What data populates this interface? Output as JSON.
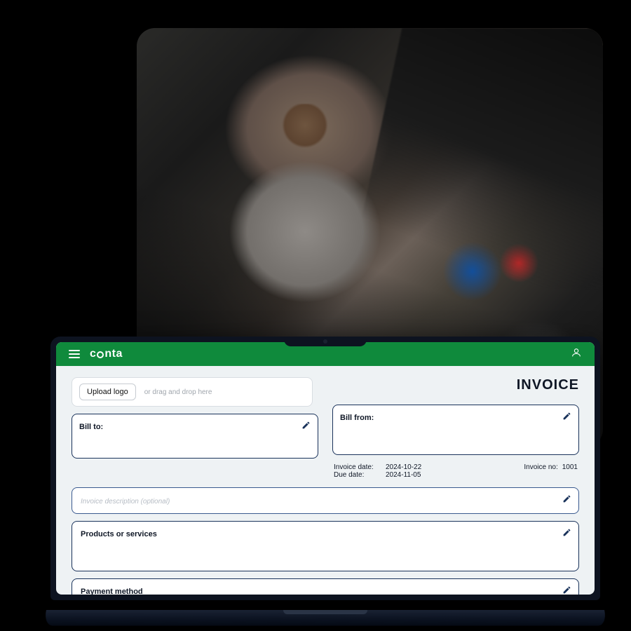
{
  "brand": {
    "name_prefix": "c",
    "name_suffix": "nta"
  },
  "header_title": "INVOICE",
  "upload": {
    "button": "Upload logo",
    "hint": "or drag and drop here"
  },
  "bill_to": {
    "label": "Bill to:"
  },
  "bill_from": {
    "label": "Bill from:"
  },
  "dates": {
    "invoice_date_label": "Invoice date:",
    "invoice_date": "2024-10-22",
    "due_date_label": "Due date:",
    "due_date": "2024-11-05",
    "invoice_no_label": "Invoice no:",
    "invoice_no": "1001"
  },
  "description": {
    "placeholder": "Invoice description (optional)"
  },
  "products": {
    "label": "Products or services"
  },
  "payment": {
    "label": "Payment method"
  },
  "colors": {
    "brand_green": "#0f8a3c",
    "outline_navy": "#19325a"
  }
}
